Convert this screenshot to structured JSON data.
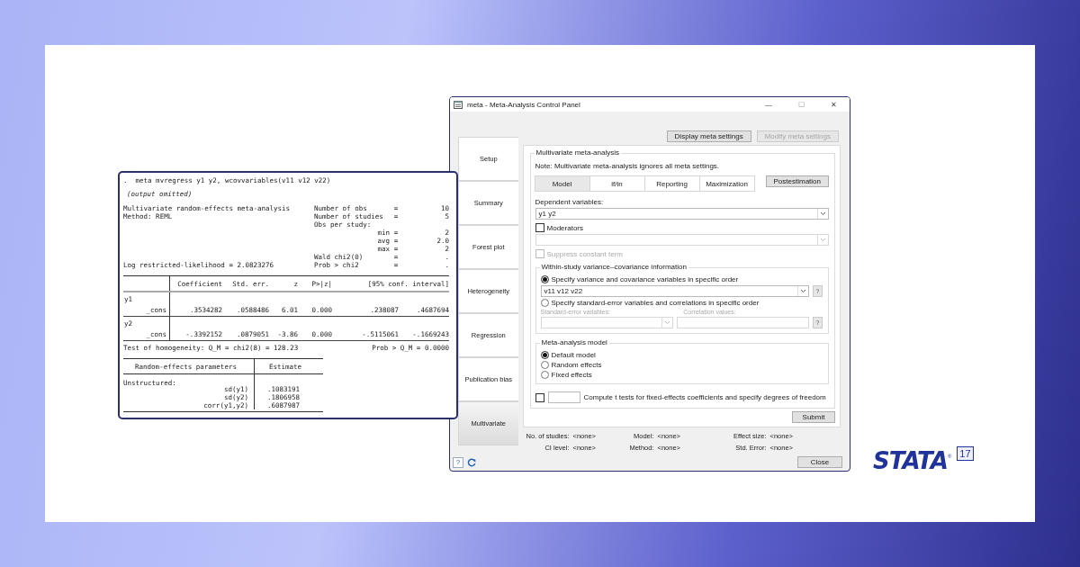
{
  "output_window": {
    "command": ".  meta mvregress y1 y2, wcovvariables(v11 v12 v22)",
    "note": "(output omitted)",
    "summary": [
      {
        "left": "Multivariate random-effects meta-analysis",
        "label": "Number of obs",
        "eq": "=",
        "value": "10"
      },
      {
        "left": "Method: REML",
        "label": "Number of studies",
        "eq": "=",
        "value": "5"
      },
      {
        "label": "Obs per study:"
      },
      {
        "label": "min",
        "eq": "=",
        "value": "2"
      },
      {
        "label": "avg",
        "eq": "=",
        "value": "2.0"
      },
      {
        "label": "max",
        "eq": "=",
        "value": "2"
      },
      {
        "label": "Wald chi2(0)",
        "eq": "=",
        "value": "."
      },
      {
        "left": "Log restricted-likelihood = 2.0823276",
        "label": "Prob > chi2",
        "eq": "=",
        "value": "."
      }
    ],
    "coef_table": {
      "columns": [
        "Coefficient",
        "Std. err.",
        "z",
        "P>|z|",
        "[95% conf. interval]"
      ],
      "rows": [
        {
          "kind": "equation",
          "label": "y1"
        },
        {
          "kind": "coef",
          "label": "_cons",
          "values": [
            ".3534282",
            ".0588486",
            "6.01",
            "0.000",
            ".238087",
            ".4687694"
          ]
        },
        {
          "kind": "equation",
          "label": "y2"
        },
        {
          "kind": "coef",
          "label": "_cons",
          "values": [
            "-.3392152",
            ".0879051",
            "-3.86",
            "0.000",
            "-.5115061",
            "-.1669243"
          ]
        }
      ]
    },
    "homogeneity": {
      "left": "Test of homogeneity: Q_M = chi2(8) = 128.23",
      "right": "Prob > Q_M = 0.0000"
    },
    "re_table": {
      "columns": [
        "Random-effects parameters",
        "Estimate"
      ],
      "group": "Unstructured:",
      "rows": [
        {
          "label": "sd(y1)",
          "value": ".1083191"
        },
        {
          "label": "sd(y2)",
          "value": ".1806958"
        },
        {
          "label": "corr(y1,y2)",
          "value": ".6087987"
        }
      ]
    }
  },
  "control_panel": {
    "title": "meta - Meta-Analysis Control Panel",
    "window_controls": [
      {
        "glyph": "—",
        "disabled": false
      },
      {
        "glyph": "☐",
        "disabled": true
      },
      {
        "glyph": "✕",
        "disabled": false
      }
    ],
    "nav": [
      {
        "label": "Setup",
        "selected": false
      },
      {
        "label": "Summary",
        "selected": false
      },
      {
        "label": "Forest plot",
        "selected": false
      },
      {
        "label": "Heterogeneity",
        "selected": false
      },
      {
        "label": "Regression",
        "selected": false
      },
      {
        "label": "Publication bias",
        "selected": false
      },
      {
        "label": "Multivariate",
        "selected": true
      }
    ],
    "top_buttons": [
      {
        "label": "Display meta settings",
        "disabled": false
      },
      {
        "label": "Modify meta settings",
        "disabled": true
      }
    ],
    "group_title": "Multivariate meta-analysis",
    "note": "Note: Multivariate meta-analysis ignores all meta settings.",
    "tabs": [
      {
        "label": "Model",
        "selected": true
      },
      {
        "label": "if/in",
        "selected": false
      },
      {
        "label": "Reporting",
        "selected": false
      },
      {
        "label": "Maximization",
        "selected": false
      }
    ],
    "postestimation": "Postestimation",
    "dependent": {
      "label": "Dependent variables:",
      "value": "y1 y2"
    },
    "moderators": {
      "label": "Moderators",
      "checked": false,
      "disabled": false
    },
    "suppress": {
      "label": "Suppress constant term",
      "checked": false,
      "disabled": true
    },
    "within": {
      "title": "Within-study variance–covariance information",
      "option1": {
        "label": "Specify variance and covariance variables in specific order",
        "selected": true
      },
      "variables": "v11 v12 v22",
      "help": "?",
      "option2": {
        "label": "Specify standard-error variables and correlations in specific order",
        "selected": false
      },
      "se_label": "Standard-error variables:",
      "corr_label": "Correlation values:",
      "help2": "?"
    },
    "model": {
      "title": "Meta-analysis model",
      "options": [
        {
          "label": "Default model",
          "selected": true
        },
        {
          "label": "Random effects",
          "selected": false
        },
        {
          "label": "Fixed effects",
          "selected": false
        }
      ]
    },
    "t_tests": {
      "label": "Compute t tests for fixed-effects coefficients and specify degrees of freedom",
      "checked": false
    },
    "submit": "Submit",
    "info": [
      {
        "label": "No. of studies:",
        "value": "<none>"
      },
      {
        "label": "Model:",
        "value": "<none>"
      },
      {
        "label": "Effect size:",
        "value": "<none>"
      },
      {
        "label": "CI level:",
        "value": "<none>"
      },
      {
        "label": "Method:",
        "value": "<none>"
      },
      {
        "label": "Std. Error:",
        "value": "<none>"
      }
    ],
    "help_button": "?",
    "close": "Close"
  },
  "logo": {
    "wordmark": "STATA",
    "registered": "®",
    "version": "17"
  }
}
